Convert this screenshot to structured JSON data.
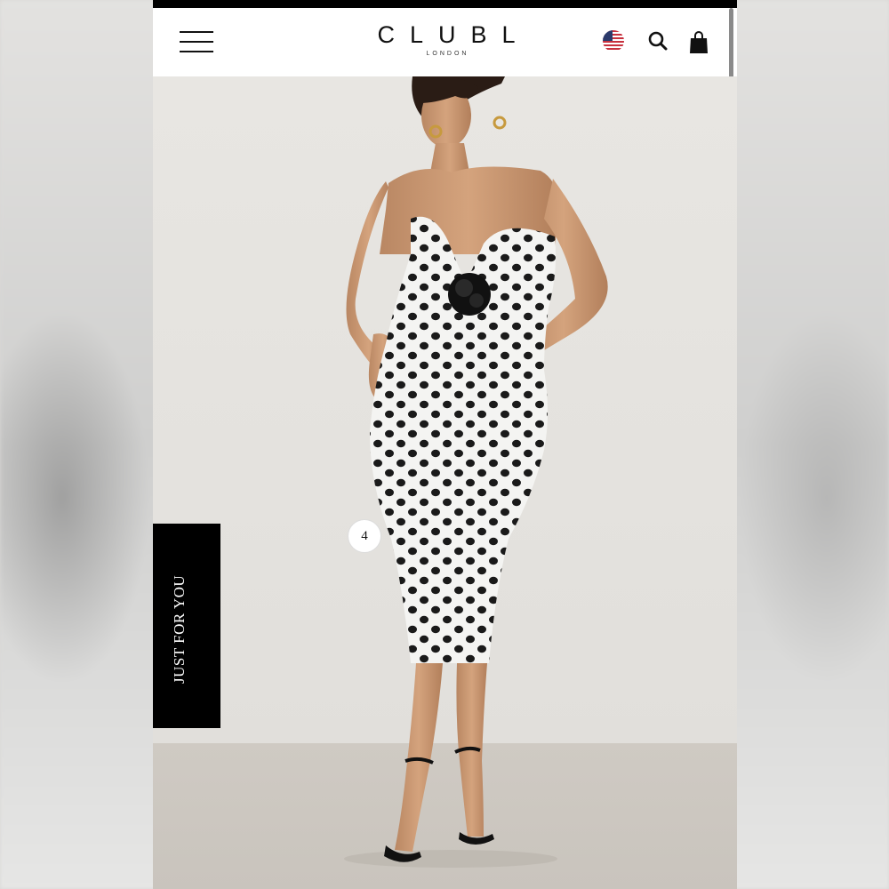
{
  "header": {
    "brand": "CLUBL",
    "brand_sub": "LONDON",
    "menu_icon": "hamburger-menu-icon",
    "flag_icon": "us-flag-icon",
    "search_icon": "search-icon",
    "bag_icon": "shopping-bag-icon"
  },
  "product_image": {
    "description_icon": "model-photo"
  },
  "just_for_you": {
    "label": "JUST FOR YOU",
    "count": "4"
  },
  "colors": {
    "header_bg": "#ffffff",
    "tab_bg": "#000000",
    "accent": "#111111"
  }
}
